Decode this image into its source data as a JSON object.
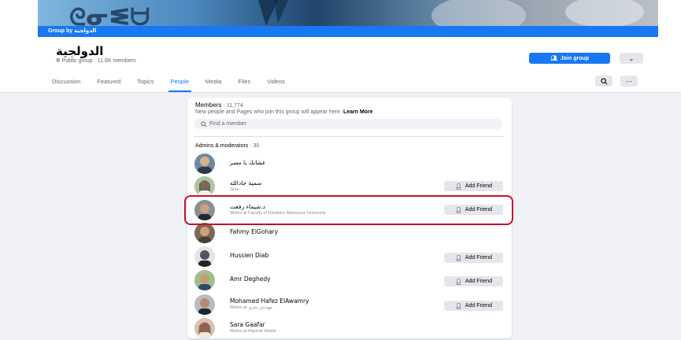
{
  "cover": {
    "strip_label": "Group by الدولجية"
  },
  "group": {
    "name": "الدولجية",
    "meta": "Public group · 11.6K members"
  },
  "actions": {
    "join_label": "Join group",
    "join_icon": "people-icon",
    "more_icon": "chevron-down-icon"
  },
  "tabs": [
    "Discussion",
    "Featured",
    "Topics",
    "People",
    "Media",
    "Files",
    "Videos"
  ],
  "active_tab": "People",
  "toolbar": {
    "search_icon": "search-icon",
    "more_icon": "ellipsis-icon",
    "more_glyph": "···"
  },
  "members": {
    "title": "Members",
    "count": "· 11,774",
    "description": "New people and Pages who join this group will appear here.",
    "learn_more": "Learn More",
    "search_placeholder": "Find a member",
    "admins_title": "Admins & moderators",
    "admins_count": "· 30",
    "add_friend_label": "Add Friend",
    "list": [
      {
        "name": "عشانك يا مصر",
        "subtitle": "",
        "add_friend": false
      },
      {
        "name": "سمية جادالله",
        "subtitle": "Giza",
        "add_friend": true
      },
      {
        "name": "د.شيماء رفعت",
        "subtitle": "Works at Faculty of Dentistry Mansoura University",
        "add_friend": true,
        "highlighted": true
      },
      {
        "name": "Fahmy ElGohary",
        "subtitle": "",
        "add_friend": false
      },
      {
        "name": "Hussien Diab",
        "subtitle": "",
        "add_friend": true
      },
      {
        "name": "Amr Deghedy",
        "subtitle": "",
        "add_friend": true
      },
      {
        "name": "Mohamed Hafez ElAwamry",
        "subtitle": "Works at مهندس بحري",
        "add_friend": true
      },
      {
        "name": "Sara Gaafar",
        "subtitle": "Works at Marriott Hotels",
        "add_friend": false
      }
    ]
  },
  "colors": {
    "accent": "#1877f2",
    "highlight": "#c8102e",
    "background": "#f0f2f5"
  }
}
